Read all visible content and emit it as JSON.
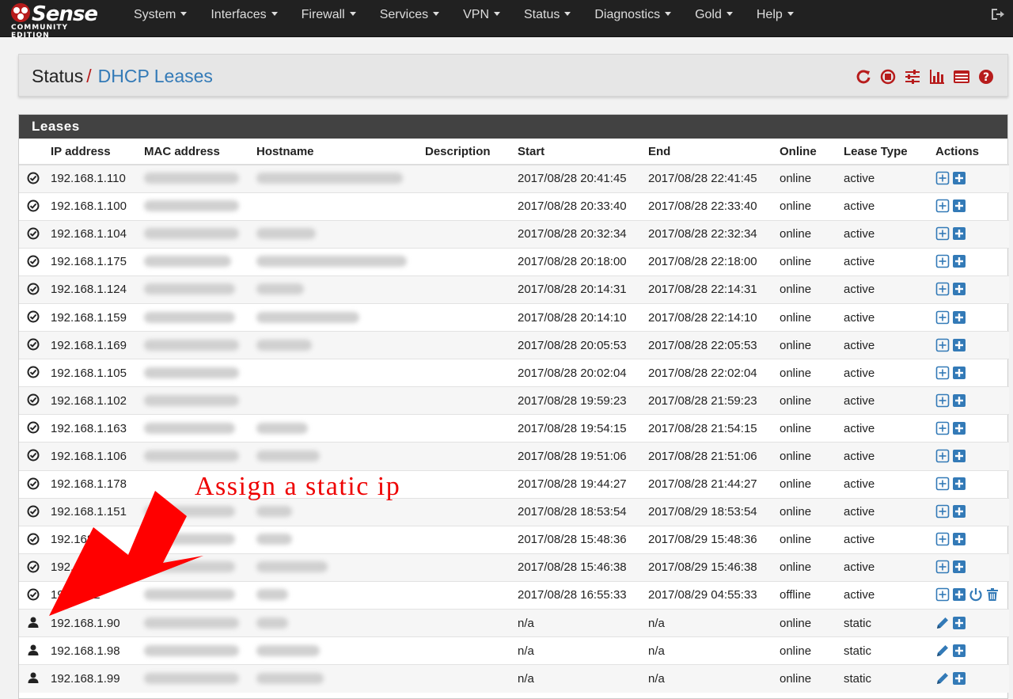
{
  "brand": {
    "name": "Sense",
    "edition": "COMMUNITY EDITION"
  },
  "nav": [
    "System",
    "Interfaces",
    "Firewall",
    "Services",
    "VPN",
    "Status",
    "Diagnostics",
    "Gold",
    "Help"
  ],
  "breadcrumb": {
    "section": "Status",
    "separator": "/",
    "page": "DHCP Leases"
  },
  "panel": {
    "title": "Leases"
  },
  "columns": [
    "IP address",
    "MAC address",
    "Hostname",
    "Description",
    "Start",
    "End",
    "Online",
    "Lease Type",
    "Actions"
  ],
  "rows": [
    {
      "ip": "192.168.1.110",
      "start": "2017/08/28 20:41:45",
      "end": "2017/08/28 22:41:45",
      "online": "online",
      "type": "active",
      "icon": "check",
      "actions": [
        "plus-outline",
        "plus"
      ],
      "mac_w": 120,
      "host_w": 185
    },
    {
      "ip": "192.168.1.100",
      "start": "2017/08/28 20:33:40",
      "end": "2017/08/28 22:33:40",
      "online": "online",
      "type": "active",
      "icon": "check",
      "actions": [
        "plus-outline",
        "plus"
      ],
      "mac_w": 120,
      "host_w": 0
    },
    {
      "ip": "192.168.1.104",
      "start": "2017/08/28 20:32:34",
      "end": "2017/08/28 22:32:34",
      "online": "online",
      "type": "active",
      "icon": "check",
      "actions": [
        "plus-outline",
        "plus"
      ],
      "mac_w": 120,
      "host_w": 75
    },
    {
      "ip": "192.168.1.175",
      "start": "2017/08/28 20:18:00",
      "end": "2017/08/28 22:18:00",
      "online": "online",
      "type": "active",
      "icon": "check",
      "actions": [
        "plus-outline",
        "plus"
      ],
      "mac_w": 110,
      "host_w": 190
    },
    {
      "ip": "192.168.1.124",
      "start": "2017/08/28 20:14:31",
      "end": "2017/08/28 22:14:31",
      "online": "online",
      "type": "active",
      "icon": "check",
      "actions": [
        "plus-outline",
        "plus"
      ],
      "mac_w": 115,
      "host_w": 60
    },
    {
      "ip": "192.168.1.159",
      "start": "2017/08/28 20:14:10",
      "end": "2017/08/28 22:14:10",
      "online": "online",
      "type": "active",
      "icon": "check",
      "actions": [
        "plus-outline",
        "plus"
      ],
      "mac_w": 115,
      "host_w": 130
    },
    {
      "ip": "192.168.1.169",
      "start": "2017/08/28 20:05:53",
      "end": "2017/08/28 22:05:53",
      "online": "online",
      "type": "active",
      "icon": "check",
      "actions": [
        "plus-outline",
        "plus"
      ],
      "mac_w": 120,
      "host_w": 70
    },
    {
      "ip": "192.168.1.105",
      "start": "2017/08/28 20:02:04",
      "end": "2017/08/28 22:02:04",
      "online": "online",
      "type": "active",
      "icon": "check",
      "actions": [
        "plus-outline",
        "plus"
      ],
      "mac_w": 120,
      "host_w": 0
    },
    {
      "ip": "192.168.1.102",
      "start": "2017/08/28 19:59:23",
      "end": "2017/08/28 21:59:23",
      "online": "online",
      "type": "active",
      "icon": "check",
      "actions": [
        "plus-outline",
        "plus"
      ],
      "mac_w": 120,
      "host_w": 0
    },
    {
      "ip": "192.168.1.163",
      "start": "2017/08/28 19:54:15",
      "end": "2017/08/28 21:54:15",
      "online": "online",
      "type": "active",
      "icon": "check",
      "actions": [
        "plus-outline",
        "plus"
      ],
      "mac_w": 115,
      "host_w": 65
    },
    {
      "ip": "192.168.1.106",
      "start": "2017/08/28 19:51:06",
      "end": "2017/08/28 21:51:06",
      "online": "online",
      "type": "active",
      "icon": "check",
      "actions": [
        "plus-outline",
        "plus"
      ],
      "mac_w": 120,
      "host_w": 80
    },
    {
      "ip": "192.168.1.178",
      "start": "2017/08/28 19:44:27",
      "end": "2017/08/28 21:44:27",
      "online": "online",
      "type": "active",
      "icon": "check",
      "actions": [
        "plus-outline",
        "plus"
      ],
      "mac_w": 0,
      "host_w": 0
    },
    {
      "ip": "192.168.1.151",
      "start": "2017/08/28 18:53:54",
      "end": "2017/08/29 18:53:54",
      "online": "online",
      "type": "active",
      "icon": "check",
      "actions": [
        "plus-outline",
        "plus"
      ],
      "mac_w": 115,
      "host_w": 45
    },
    {
      "ip": "192.168.1.",
      "start": "2017/08/28 15:48:36",
      "end": "2017/08/29 15:48:36",
      "online": "online",
      "type": "active",
      "icon": "check",
      "actions": [
        "plus-outline",
        "plus"
      ],
      "mac_w": 115,
      "host_w": 45
    },
    {
      "ip": "192.16",
      "start": "2017/08/28 15:46:38",
      "end": "2017/08/29 15:46:38",
      "online": "online",
      "type": "active",
      "icon": "check",
      "actions": [
        "plus-outline",
        "plus"
      ],
      "mac_w": 115,
      "host_w": 90
    },
    {
      "ip": "19 .1.162",
      "start": "2017/08/28 16:55:33",
      "end": "2017/08/29 04:55:33",
      "online": "offline",
      "type": "active",
      "icon": "check",
      "actions": [
        "plus-outline",
        "plus",
        "power",
        "trash"
      ],
      "mac_w": 115,
      "host_w": 40
    },
    {
      "ip": "192.168.1.90",
      "start": "n/a",
      "end": "n/a",
      "online": "online",
      "type": "static",
      "icon": "user",
      "actions": [
        "pencil",
        "plus"
      ],
      "mac_w": 120,
      "host_w": 40
    },
    {
      "ip": "192.168.1.98",
      "start": "n/a",
      "end": "n/a",
      "online": "online",
      "type": "static",
      "icon": "user",
      "actions": [
        "pencil",
        "plus"
      ],
      "mac_w": 120,
      "host_w": 80
    },
    {
      "ip": "192.168.1.99",
      "start": "n/a",
      "end": "n/a",
      "online": "online",
      "type": "static",
      "icon": "user",
      "actions": [
        "pencil",
        "plus"
      ],
      "mac_w": 120,
      "host_w": 85
    }
  ],
  "annotation": {
    "text": "Assign a static ip",
    "color": "#e00000"
  },
  "colors": {
    "navbar": "#212121",
    "accent_red": "#b71c1c",
    "link_blue": "#337ab7",
    "action_blue": "#337ab7"
  }
}
